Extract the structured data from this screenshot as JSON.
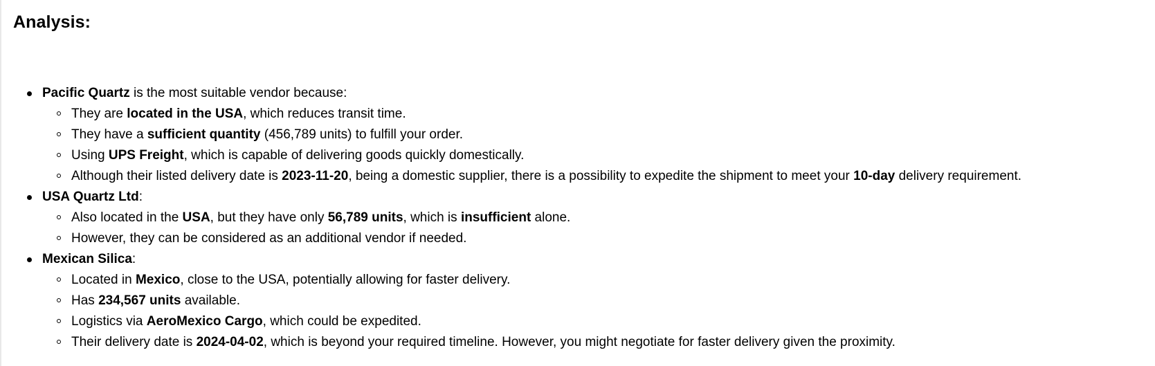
{
  "heading": "Analysis:",
  "vendors": [
    {
      "name": "Pacific Quartz",
      "intro": " is the most suitable vendor because:",
      "points": [
        {
          "a": "They are ",
          "b": "located in the USA",
          "c": ", which reduces transit time."
        },
        {
          "a": "They have a ",
          "b": "sufficient quantity",
          "c": " (456,789 units) to fulfill your order."
        },
        {
          "a": "Using ",
          "b": "UPS Freight",
          "c": ", which is capable of delivering goods quickly domestically."
        },
        {
          "a": "Although their listed delivery date is ",
          "b": "2023-11-20",
          "c": ", being a domestic supplier, there is a possibility to expedite the shipment to meet your ",
          "d": "10-day",
          "e": " delivery requirement."
        }
      ]
    },
    {
      "name": "USA Quartz Ltd",
      "intro": ":",
      "points": [
        {
          "a": "Also located in the ",
          "b": "USA",
          "c": ", but they have only ",
          "d": "56,789 units",
          "e": ", which is ",
          "f": "insufficient",
          "g": " alone."
        },
        {
          "a": "However, they can be considered as an additional vendor if needed."
        }
      ]
    },
    {
      "name": "Mexican Silica",
      "intro": ":",
      "points": [
        {
          "a": "Located in ",
          "b": "Mexico",
          "c": ", close to the USA, potentially allowing for faster delivery."
        },
        {
          "a": "Has ",
          "b": "234,567 units",
          "c": " available."
        },
        {
          "a": "Logistics via ",
          "b": "AeroMexico Cargo",
          "c": ", which could be expedited."
        },
        {
          "a": "Their delivery date is ",
          "b": "2024-04-02",
          "c": ", which is beyond your required timeline. However, you might negotiate for faster delivery given the proximity."
        }
      ]
    }
  ]
}
